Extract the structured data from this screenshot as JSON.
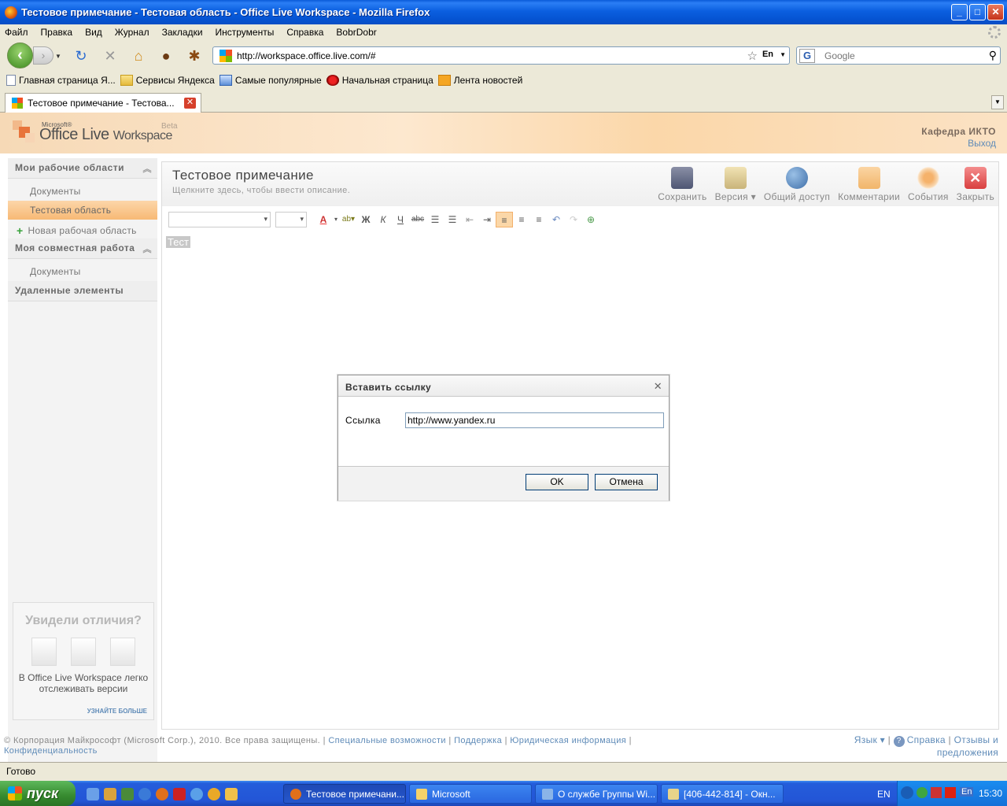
{
  "window": {
    "title": "Тестовое примечание - Тестовая область - Office Live Workspace - Mozilla Firefox"
  },
  "menu": [
    "Файл",
    "Правка",
    "Вид",
    "Журнал",
    "Закладки",
    "Инструменты",
    "Справка",
    "BobrDobr"
  ],
  "nav": {
    "url": "http://workspace.office.live.com/#",
    "lang": "En",
    "search_placeholder": "Google"
  },
  "bookmarks": [
    {
      "label": "Главная страница Я...",
      "icon": "page-icon"
    },
    {
      "label": "Сервисы Яндекса",
      "icon": "folder-icon"
    },
    {
      "label": "Самые популярные",
      "icon": "popular-icon"
    },
    {
      "label": "Начальная страница",
      "icon": "bug-icon"
    },
    {
      "label": "Лента новостей",
      "icon": "rss-icon"
    }
  ],
  "tab": {
    "label": "Тестовое примечание - Тестова..."
  },
  "olw": {
    "ms": "Microsoft®",
    "brand": "Office Live",
    "brand2": "Workspace",
    "beta": "Beta",
    "org": "Кафедра ИКТО",
    "logout": "Выход"
  },
  "sidebar": {
    "my_workspaces": "Мои рабочие области",
    "documents1": "Документы",
    "test_area": "Тестовая область",
    "new_area": "Новая рабочая область",
    "shared": "Моя совместная работа",
    "documents2": "Документы",
    "deleted": "Удаленные элементы"
  },
  "promo": {
    "title": "Увидели отличия?",
    "text": "В Office Live Workspace легко отслеживать версии",
    "more": "УЗНАЙТЕ БОЛЬШЕ"
  },
  "doc": {
    "title": "Тестовое примечание",
    "description": "Щелкните здесь, чтобы ввести описание.",
    "body": "Тест"
  },
  "actions": {
    "save": "Сохранить",
    "version": "Версия ▾",
    "share": "Общий доступ",
    "comments": "Комментарии",
    "events": "События",
    "close": "Закрыть"
  },
  "format": {
    "bold": "Ж",
    "italic": "К",
    "underline": "Ч",
    "strike": "abc"
  },
  "footer": {
    "copyright": "© Корпорация Майкрософт (Microsoft Corp.), 2010. Все права защищены.",
    "accessibility": "Специальные возможности",
    "support": "Поддержка",
    "legal": "Юридическая информация",
    "privacy": "Конфиденциальность",
    "language": "Язык ▾",
    "help": "Справка",
    "feedback1": "Отзывы и",
    "feedback2": "предложения"
  },
  "dialog": {
    "title": "Вставить ссылку",
    "link_label": "Ссылка",
    "link_value": "http://www.yandex.ru",
    "ok": "OK",
    "cancel": "Отмена"
  },
  "status": "Готово",
  "taskbar": {
    "start": "пуск",
    "tasks": [
      "Тестовое примечани...",
      "Microsoft",
      "О службе Группы Wi...",
      "[406-442-814] - Окн..."
    ],
    "lang": "EN",
    "tray_lang": "En",
    "time": "15:30"
  },
  "colors": {
    "accent_orange": "#f7b975",
    "link_blue": "#5f8bb8",
    "xp_blue": "#245ddb"
  }
}
